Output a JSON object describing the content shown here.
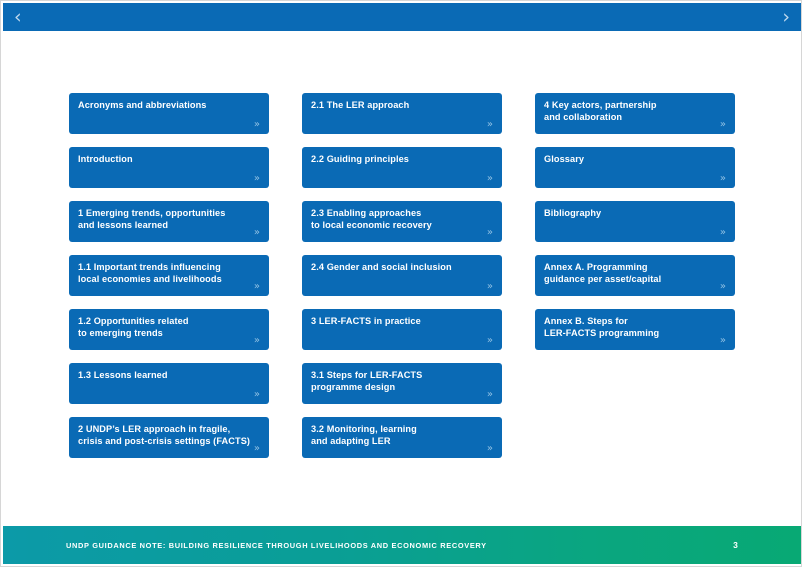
{
  "topbar": {
    "prev_icon": "chevron-left-icon",
    "prev_label": "‹",
    "next_icon": "chevron-right-icon",
    "next_label": "›",
    "background_color": "#0a6ab5"
  },
  "toc": {
    "item_chevron": "»",
    "item_color": "#0a6ab5",
    "columns": [
      {
        "name": "column-1",
        "items": [
          {
            "label": "Acronyms and abbreviations"
          },
          {
            "label": "Introduction"
          },
          {
            "label": "1 Emerging trends, opportunities\nand lessons learned"
          },
          {
            "label": "1.1 Important trends influencing\nlocal economies and livelihoods"
          },
          {
            "label": "1.2 Opportunities related\nto emerging trends"
          },
          {
            "label": "1.3 Lessons learned"
          },
          {
            "label": "2 UNDP’s LER approach in fragile,\ncrisis and post-crisis settings (FACTS)"
          }
        ]
      },
      {
        "name": "column-2",
        "items": [
          {
            "label": "2.1 The LER approach"
          },
          {
            "label": "2.2 Guiding principles"
          },
          {
            "label": "2.3 Enabling approaches\nto local economic recovery"
          },
          {
            "label": "2.4 Gender and social inclusion"
          },
          {
            "label": "3 LER-FACTS in practice"
          },
          {
            "label": "3.1 Steps for LER-FACTS\nprogramme design"
          },
          {
            "label": "3.2 Monitoring, learning\nand adapting LER"
          }
        ]
      },
      {
        "name": "column-3",
        "items": [
          {
            "label": "4 Key actors, partnership\nand collaboration"
          },
          {
            "label": "Glossary"
          },
          {
            "label": "Bibliography"
          },
          {
            "label": "Annex A. Programming\nguidance per asset/capital"
          },
          {
            "label": "Annex B. Steps for\nLER-FACTS programming"
          }
        ]
      }
    ]
  },
  "footer": {
    "title": "UNDP GUIDANCE NOTE: BUILDING RESILIENCE THROUGH LIVELIHOODS AND ECONOMIC RECOVERY",
    "page_number": "3",
    "gradient_start": "#0c9aa8",
    "gradient_end": "#08a974"
  }
}
